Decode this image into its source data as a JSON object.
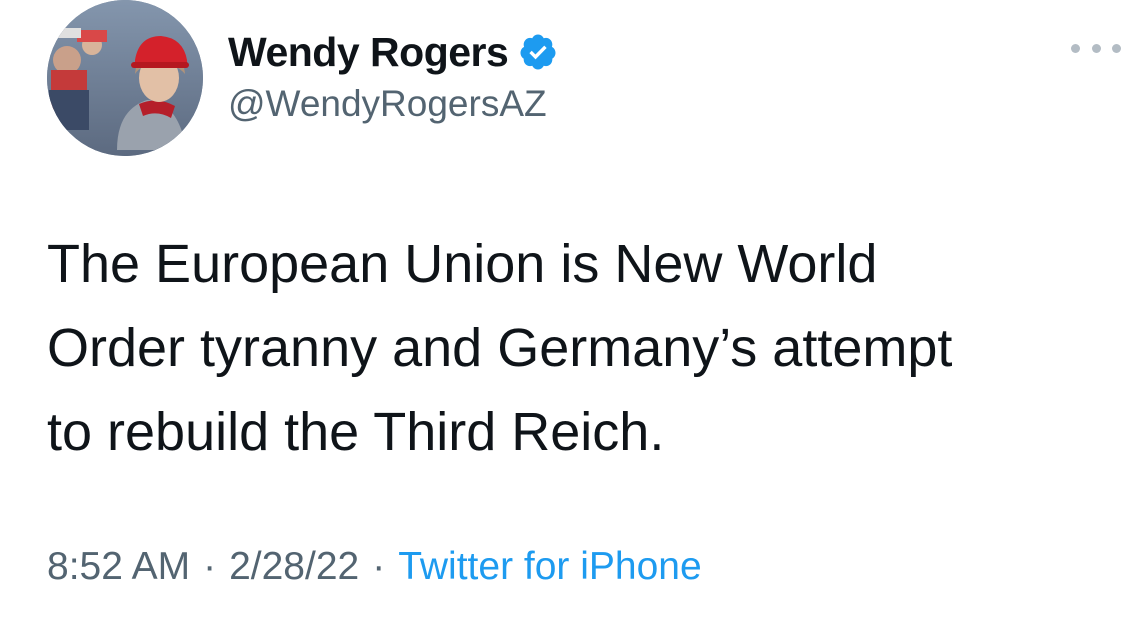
{
  "author": {
    "display_name": "Wendy Rogers",
    "handle": "@WendyRogersAZ",
    "verified": true,
    "avatar_icon": "profile-photo"
  },
  "tweet": {
    "text_lines": [
      "The European Union is New World",
      "Order tyranny and Germany’s attempt",
      "to rebuild the Third Reich."
    ]
  },
  "meta": {
    "time": "8:52 AM",
    "separator": "·",
    "date": "2/28/22",
    "source": "Twitter for iPhone"
  },
  "icons": {
    "more": "more-horizontal-icon",
    "verified": "verified-badge-icon"
  },
  "colors": {
    "text": "#0f1419",
    "secondary": "#536471",
    "link": "#1d9bf0",
    "verified": "#1d9bf0"
  }
}
